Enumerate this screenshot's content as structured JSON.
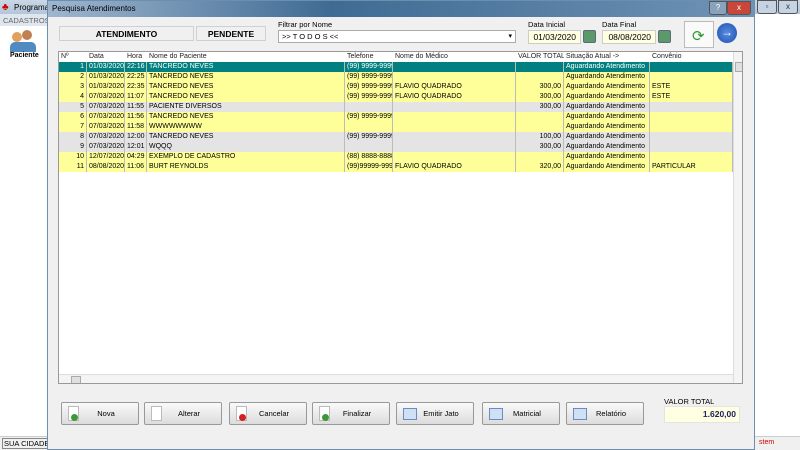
{
  "background_app": {
    "title": "Programa",
    "menu": "CADASTROS",
    "sidebar_item": "Paciente",
    "status_city": "SUA CIDADE",
    "status_right": "stem"
  },
  "dialog": {
    "title": "Pesquisa Atendimentos",
    "help": "?",
    "close": "x"
  },
  "header": {
    "atendimento": "ATENDIMENTO",
    "pendente": "PENDENTE",
    "filter_label": "Filtrar por Nome",
    "filter_value": ">> T O D O S <<",
    "data_inicial_label": "Data Inicial",
    "data_inicial": "01/03/2020",
    "data_final_label": "Data Final",
    "data_final": "08/08/2020"
  },
  "grid": {
    "columns": [
      "Nº",
      "Data",
      "Hora",
      "Nome do Paciente",
      "Telefone",
      "Nome do Médico",
      "VALOR TOTAL",
      "Situação Atual ->",
      "Convênio"
    ],
    "rows": [
      [
        "1",
        "01/03/2020",
        "22:16",
        "TANCREDO NEVES",
        "(99) 9999-9999",
        "",
        "",
        "Aguardando Atendimento",
        ""
      ],
      [
        "2",
        "01/03/2020",
        "22:25",
        "TANCREDO NEVES",
        "(99) 9999-9999",
        "",
        "",
        "Aguardando Atendimento",
        ""
      ],
      [
        "3",
        "01/03/2020",
        "22:35",
        "TANCREDO NEVES",
        "(99) 9999-9999",
        "FLAVIO QUADRADO",
        "300,00",
        "Aguardando Atendimento",
        "ESTE"
      ],
      [
        "4",
        "07/03/2020",
        "11:07",
        "TANCREDO NEVES",
        "(99) 9999-9999",
        "FLAVIO QUADRADO",
        "300,00",
        "Aguardando Atendimento",
        "ESTE"
      ],
      [
        "5",
        "07/03/2020",
        "11:55",
        "PACIENTE DIVERSOS",
        "",
        "",
        "300,00",
        "Aguardando Atendimento",
        ""
      ],
      [
        "6",
        "07/03/2020",
        "11:56",
        "TANCREDO NEVES",
        "(99) 9999-9999",
        "",
        "",
        "Aguardando Atendimento",
        ""
      ],
      [
        "7",
        "07/03/2020",
        "11:58",
        "WWWWWWWW",
        "",
        "",
        "",
        "Aguardando Atendimento",
        ""
      ],
      [
        "8",
        "07/03/2020",
        "12:00",
        "TANCREDO NEVES",
        "(99) 9999-9999",
        "",
        "100,00",
        "Aguardando Atendimento",
        ""
      ],
      [
        "9",
        "07/03/2020",
        "12:01",
        "WQQQ",
        "",
        "",
        "300,00",
        "Aguardando Atendimento",
        ""
      ],
      [
        "10",
        "12/07/2020",
        "04:29",
        "EXEMPLO DE CADASTRO",
        "(88) 8888-8888",
        "",
        "",
        "Aguardando Atendimento",
        ""
      ],
      [
        "11",
        "08/08/2020",
        "11:06",
        "BURT REYNOLDS",
        "(99)99999-9999",
        "FLAVIO QUADRADO",
        "320,00",
        "Aguardando Atendimento",
        "PARTICULAR"
      ]
    ],
    "row_colors": [
      "selected",
      "yellow",
      "yellow",
      "yellow",
      "gray",
      "yellow",
      "yellow",
      "gray",
      "gray",
      "yellow",
      "yellow"
    ],
    "colors": {
      "selected": "#008080",
      "yellow": "#ffff99",
      "gray": "#e4e4e4"
    }
  },
  "buttons": [
    "Nova",
    "Alterar",
    "Cancelar",
    "Finalizar",
    "Emitir Jato",
    "Matricial",
    "Relatório"
  ],
  "total": {
    "label": "VALOR TOTAL",
    "value": "1.620,00"
  }
}
